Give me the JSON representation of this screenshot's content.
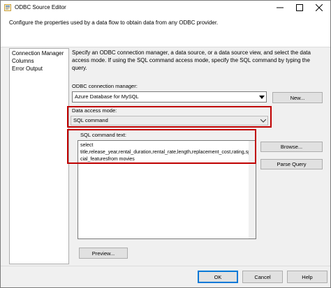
{
  "window": {
    "title": "ODBC Source Editor"
  },
  "header": {
    "description": "Configure the properties used by a data flow to obtain data from any ODBC provider."
  },
  "nav": {
    "items": [
      "Connection Manager",
      "Columns",
      "Error Output"
    ]
  },
  "main": {
    "instructions": "Specify an ODBC connection manager, a data source, or a data source view, and select the data access mode. If using the SQL command access mode, specify the SQL command by typing the query.",
    "connection_label": "ODBC connection manager:",
    "connection_value": "Azure Database for MySQL",
    "new_label": "New...",
    "access_mode_label": "Data access mode:",
    "access_mode_value": "SQL command",
    "sql_label": "SQL command text:",
    "sql_text": "select\ntitle,release_year,rental_duration,rental_rate,length,replacement_cost,rating,special_featuresfrom movies",
    "browse_label": "Browse...",
    "parse_label": "Parse Query",
    "preview_label": "Preview..."
  },
  "footer": {
    "ok_label": "OK",
    "cancel_label": "Cancel",
    "help_label": "Help"
  },
  "colors": {
    "highlight": "#c00000",
    "accent": "#0078d7"
  },
  "icons": {
    "app": "odbc-source-icon",
    "minimize": "minimize-icon",
    "maximize": "maximize-icon",
    "close": "close-icon",
    "dropdown": "chevron-down-icon"
  }
}
